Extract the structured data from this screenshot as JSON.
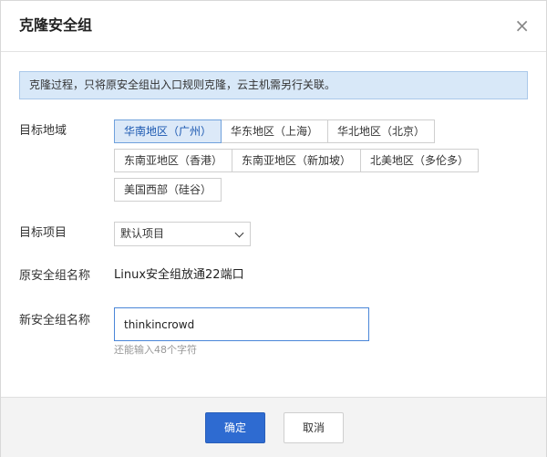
{
  "dialog": {
    "title": "克隆安全组",
    "close_glyph": "×"
  },
  "notice": "克隆过程，只将原安全组出入口规则克隆，云主机需另行关联。",
  "region": {
    "label": "目标地域",
    "rows": [
      [
        "华南地区（广州）",
        "华东地区（上海）",
        "华北地区（北京）"
      ],
      [
        "东南亚地区（香港）",
        "东南亚地区（新加坡）",
        "北美地区（多伦多）"
      ],
      [
        "美国西部（硅谷）"
      ]
    ],
    "selected": "华南地区（广州）"
  },
  "project": {
    "label": "目标项目",
    "value": "默认项目"
  },
  "source_name": {
    "label": "原安全组名称",
    "value": "Linux安全组放通22端口"
  },
  "new_name": {
    "label": "新安全组名称",
    "value": "thinkincrowd",
    "hint": "还能输入48个字符"
  },
  "footer": {
    "ok_label": "确定",
    "cancel_label": "取消"
  },
  "colors": {
    "primary": "#2e6bd1",
    "notice_bg": "#d8e8f8",
    "selected_bg": "#dce9f8"
  }
}
